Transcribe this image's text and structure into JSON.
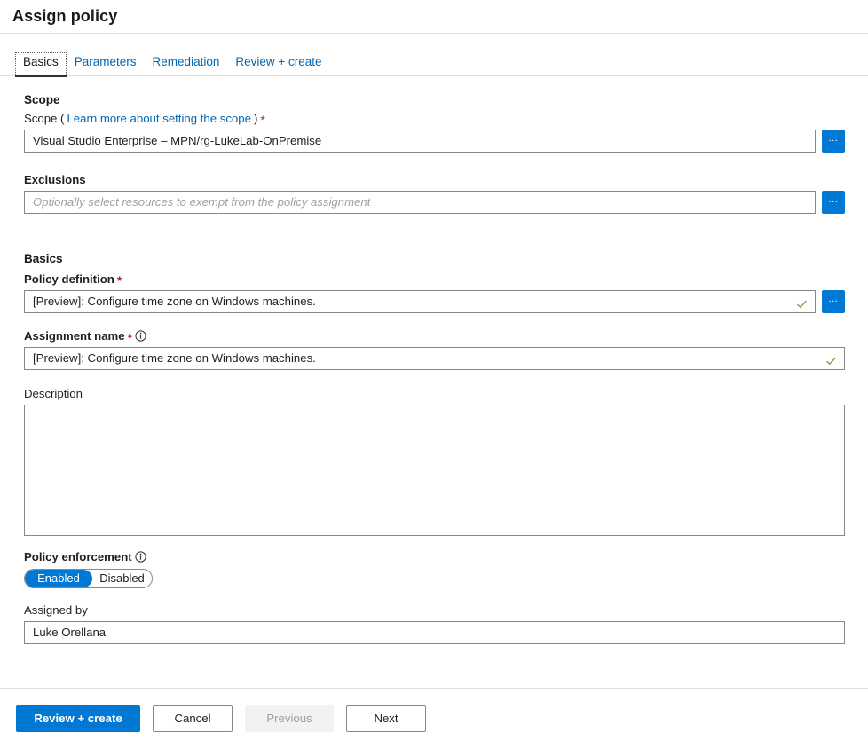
{
  "header": {
    "title": "Assign policy"
  },
  "tabs": [
    {
      "label": "Basics",
      "active": true
    },
    {
      "label": "Parameters",
      "active": false
    },
    {
      "label": "Remediation",
      "active": false
    },
    {
      "label": "Review + create",
      "active": false
    }
  ],
  "scope_section": {
    "heading": "Scope",
    "scope_label_prefix": "Scope (",
    "scope_link": "Learn more about setting the scope",
    "scope_label_suffix": ")",
    "required_mark": "*",
    "scope_value": "Visual Studio Enterprise – MPN/rg-LukeLab-OnPremise",
    "browse_label": "...",
    "exclusions_label": "Exclusions",
    "exclusions_placeholder": "Optionally select resources to exempt from the policy assignment",
    "exclusions_value": ""
  },
  "basics_section": {
    "heading": "Basics",
    "policy_definition_label": "Policy definition",
    "policy_definition_value": "[Preview]: Configure time zone on Windows machines.",
    "policy_definition_browse": "...",
    "assignment_name_label": "Assignment name",
    "assignment_name_value": "[Preview]: Configure time zone on Windows machines.",
    "description_label": "Description",
    "description_value": "",
    "policy_enforcement_label": "Policy enforcement",
    "enforcement_enabled": "Enabled",
    "enforcement_disabled": "Disabled",
    "enforcement_selected": "Enabled",
    "assigned_by_label": "Assigned by",
    "assigned_by_value": "Luke Orellana"
  },
  "footer": {
    "review_create": "Review + create",
    "cancel": "Cancel",
    "previous": "Previous",
    "next": "Next"
  },
  "colors": {
    "accent": "#0078d4",
    "link": "#0066b4",
    "required": "#a4262c",
    "valid": "#6aa84f",
    "border": "#8a8886",
    "divider": "#e1dfdd"
  }
}
